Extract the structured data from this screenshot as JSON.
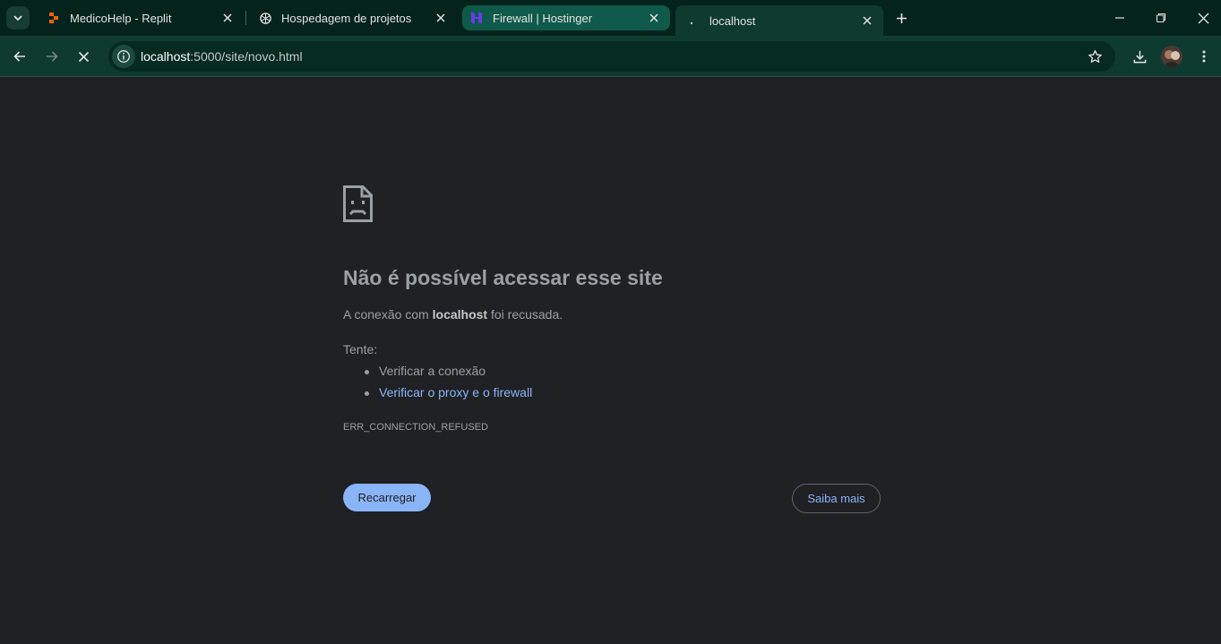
{
  "tabs": [
    {
      "title": "MedicoHelp - Replit",
      "icon": "replit-icon"
    },
    {
      "title": "Hospedagem de projetos",
      "icon": "openai-icon"
    },
    {
      "title": "Firewall | Hostinger",
      "icon": "hostinger-icon"
    },
    {
      "title": "localhost",
      "icon": "loading-icon"
    }
  ],
  "address_bar": {
    "host": "localhost",
    "path": ":5000/site/novo.html"
  },
  "error_page": {
    "heading": "Não é possível acessar esse site",
    "desc_prefix": "A conexão com ",
    "desc_host": "localhost",
    "desc_suffix": " foi recusada.",
    "try_label": "Tente:",
    "suggestions": [
      "Verificar a conexão",
      "Verificar o proxy e o firewall"
    ],
    "error_code": "ERR_CONNECTION_REFUSED",
    "reload_label": "Recarregar",
    "learn_more_label": "Saiba mais"
  },
  "colors": {
    "tab_strip": "#04231c",
    "toolbar": "#0f3a30",
    "page_bg": "#202124",
    "accent": "#8ab4f8"
  }
}
